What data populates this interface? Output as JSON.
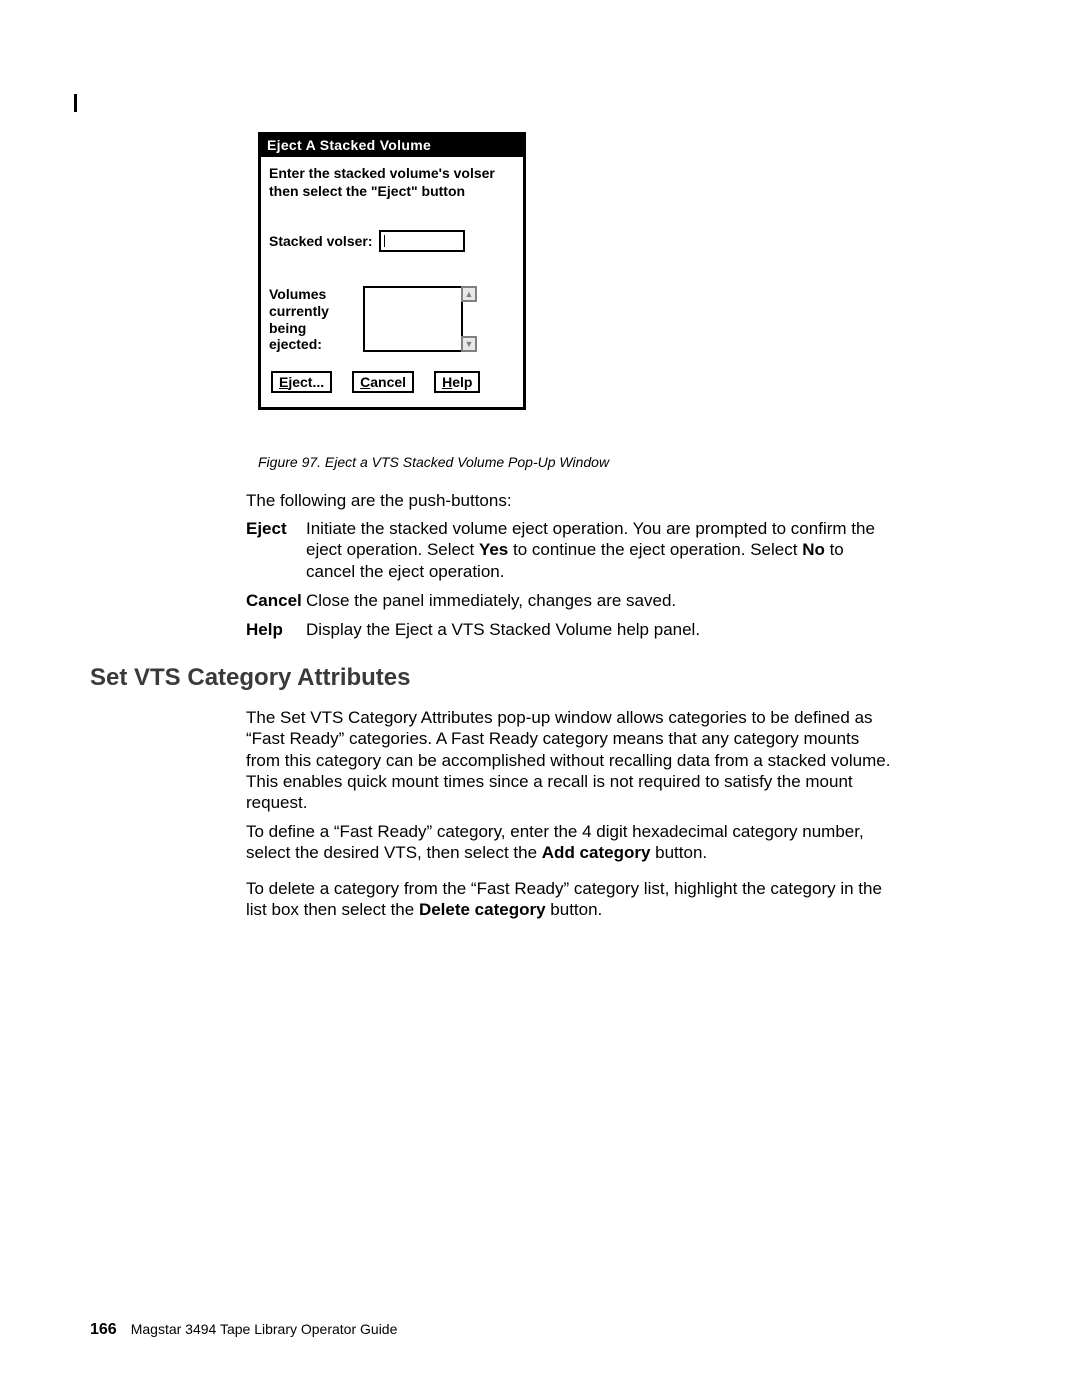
{
  "dialog": {
    "title": "Eject A Stacked Volume",
    "instruction_l1": "Enter the stacked volume's volser",
    "instruction_l2": "then select the \"Eject\" button",
    "volser_label": "Stacked volser:",
    "ejecting_label_l1": "Volumes",
    "ejecting_label_l2": "currently",
    "ejecting_label_l3": "being",
    "ejecting_label_l4": "ejected:",
    "buttons": {
      "eject_u": "E",
      "eject_rest": "ject...",
      "cancel_u": "C",
      "cancel_rest": "ancel",
      "help_u": "H",
      "help_rest": "elp"
    }
  },
  "figure_caption": "Figure 97. Eject a VTS Stacked Volume Pop-Up Window",
  "intro": "The following are the push-buttons:",
  "defs": {
    "eject": {
      "term": "Eject",
      "d1": "Initiate the stacked volume eject operation. You are prompted to confirm the eject operation. Select ",
      "d2": "Yes",
      "d3": " to continue the eject operation. Select ",
      "d4": "No",
      "d5": " to cancel the eject operation."
    },
    "cancel": {
      "term": "Cancel",
      "d": "Close the panel immediately, changes are saved."
    },
    "help": {
      "term": "Help",
      "d": "Display the Eject a VTS Stacked Volume help panel."
    }
  },
  "h2": "Set VTS Category Attributes",
  "p1": "The Set VTS Category Attributes pop-up window allows categories to be defined as “Fast Ready” categories. A Fast Ready category means that any category mounts from this category can be accomplished without recalling data from a stacked volume. This enables quick mount times since a recall is not required to satisfy the mount request.",
  "p2a": "To define a “Fast Ready” category, enter the 4 digit hexadecimal category number, select the desired VTS, then select the ",
  "p2b": "Add category",
  "p2c": " button.",
  "p3a": "To delete a category from the “Fast Ready” category list, highlight the category in the list box then select the ",
  "p3b": "Delete category",
  "p3c": " button.",
  "footer": {
    "page": "166",
    "title": "Magstar 3494 Tape Library Operator Guide"
  }
}
